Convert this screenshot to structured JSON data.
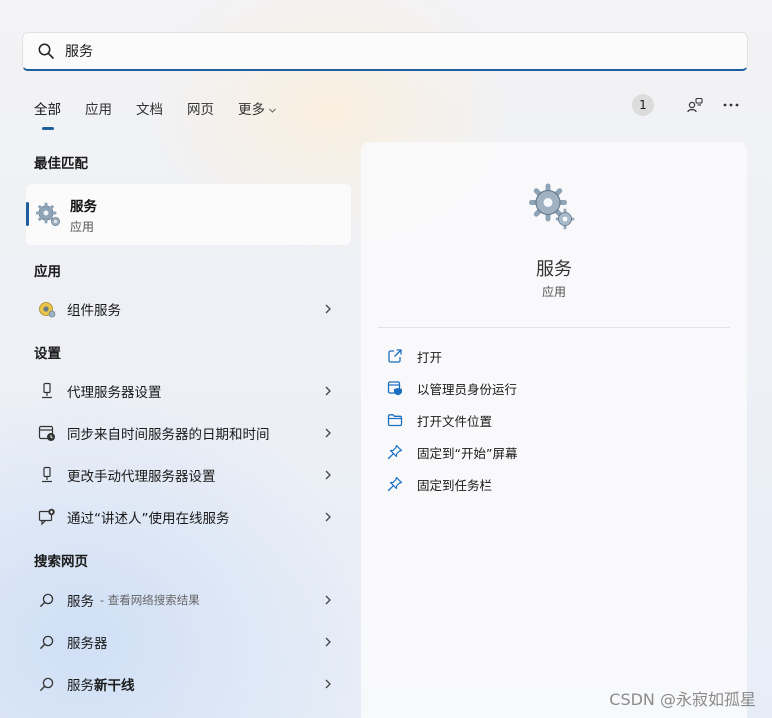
{
  "search": {
    "value": "服务",
    "placeholder": ""
  },
  "tabs": [
    {
      "label": "全部"
    },
    {
      "label": "应用"
    },
    {
      "label": "文档"
    },
    {
      "label": "网页"
    },
    {
      "label": "更多"
    }
  ],
  "header": {
    "badge": "1"
  },
  "best_match": {
    "heading": "最佳匹配",
    "title": "服务",
    "subtitle": "应用"
  },
  "apps": {
    "heading": "应用",
    "items": [
      {
        "label": "组件服务"
      }
    ]
  },
  "settings": {
    "heading": "设置",
    "items": [
      {
        "label": "代理服务器设置"
      },
      {
        "label": "同步来自时间服务器的日期和时间"
      },
      {
        "label": "更改手动代理服务器设置"
      },
      {
        "label": "通过“讲述人”使用在线服务"
      }
    ]
  },
  "web": {
    "heading": "搜索网页",
    "items": [
      {
        "label": "服务",
        "suffix": "- 查看网络搜索结果"
      },
      {
        "label": "服务器"
      },
      {
        "label": "服务",
        "bold": "新干线"
      }
    ]
  },
  "details": {
    "title": "服务",
    "subtitle": "应用",
    "actions": [
      {
        "label": "打开",
        "icon": "open-external-icon"
      },
      {
        "label": "以管理员身份运行",
        "icon": "shield-admin-icon"
      },
      {
        "label": "打开文件位置",
        "icon": "folder-icon"
      },
      {
        "label": "固定到“开始”屏幕",
        "icon": "pin-icon"
      },
      {
        "label": "固定到任务栏",
        "icon": "pin-icon"
      }
    ]
  },
  "watermark": "CSDN @永寂如孤星",
  "colors": {
    "accent": "#1f5f9f",
    "icon_blue": "#1a6fc0"
  }
}
